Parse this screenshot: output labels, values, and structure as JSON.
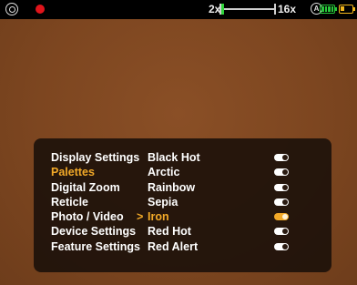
{
  "status_bar": {
    "logo_icon": "device-logo-icon",
    "record_icon": "record-dot-icon",
    "record_color": "#e0141b",
    "zoom_min": "2x",
    "zoom_max": "16x",
    "zoom_level": "2x",
    "auto_icon": "auto-mode-icon",
    "auto_label": "A",
    "battery_internal": {
      "icon": "battery-icon",
      "color": "#27c83a",
      "level": "full"
    },
    "battery_external": {
      "icon": "battery-low-icon",
      "color": "#f3b81c",
      "level": "low"
    }
  },
  "menu": {
    "items": [
      {
        "label": "Display Settings",
        "active": false
      },
      {
        "label": "Palettes",
        "active": true
      },
      {
        "label": "Digital Zoom",
        "active": false
      },
      {
        "label": "Reticle",
        "active": false
      },
      {
        "label": "Photo / Video",
        "active": false
      },
      {
        "label": "Device Settings",
        "active": false
      },
      {
        "label": "Feature Settings",
        "active": false
      }
    ],
    "accent_color": "#f2a928"
  },
  "palettes": {
    "selector_glyph": ">",
    "options": [
      {
        "label": "Black Hot",
        "enabled": true,
        "selected": false
      },
      {
        "label": "Arctic",
        "enabled": true,
        "selected": false
      },
      {
        "label": "Rainbow",
        "enabled": true,
        "selected": false
      },
      {
        "label": "Sepia",
        "enabled": true,
        "selected": false
      },
      {
        "label": "Iron",
        "enabled": true,
        "selected": true
      },
      {
        "label": "Red Hot",
        "enabled": true,
        "selected": false
      },
      {
        "label": "Red Alert",
        "enabled": true,
        "selected": false
      }
    ]
  }
}
